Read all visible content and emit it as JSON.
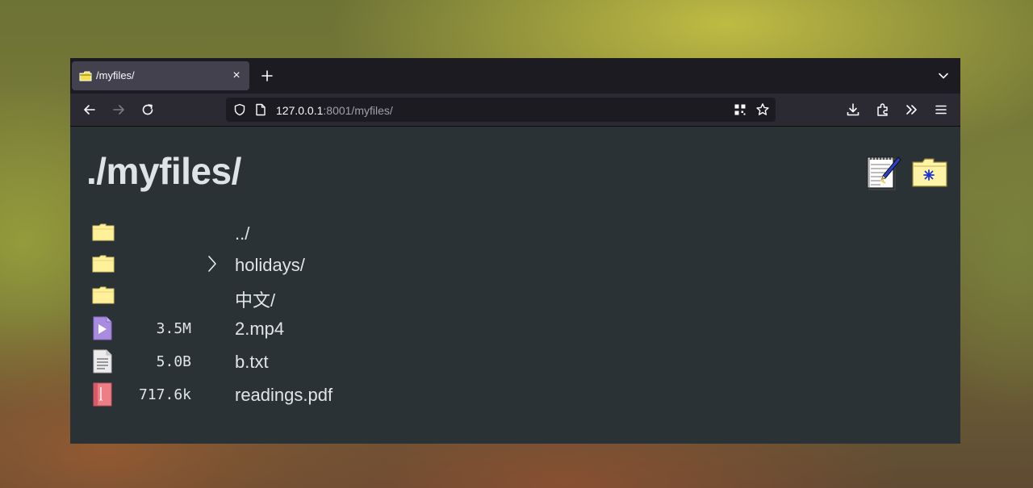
{
  "browser": {
    "tab": {
      "title": "/myfiles/",
      "favicon": "folder-icon"
    },
    "url": {
      "host": "127.0.0.1",
      "rest": ":8001/myfiles/"
    }
  },
  "page": {
    "title": "./myfiles/",
    "entries": [
      {
        "name": "../",
        "size": "",
        "icon": "folder-icon"
      },
      {
        "name": "holidays/",
        "size": "",
        "icon": "folder-icon"
      },
      {
        "name": "中文/",
        "size": "",
        "icon": "folder-icon"
      },
      {
        "name": "2.mp4",
        "size": "3.5M",
        "icon": "video-file-icon"
      },
      {
        "name": "b.txt",
        "size": "5.0B",
        "icon": "text-file-icon"
      },
      {
        "name": "readings.pdf",
        "size": "717.6k",
        "icon": "pdf-file-icon"
      }
    ]
  },
  "colors": {
    "accent_folder": "#fff09a",
    "video": "#9b7fd6",
    "pdf": "#e86f78"
  }
}
